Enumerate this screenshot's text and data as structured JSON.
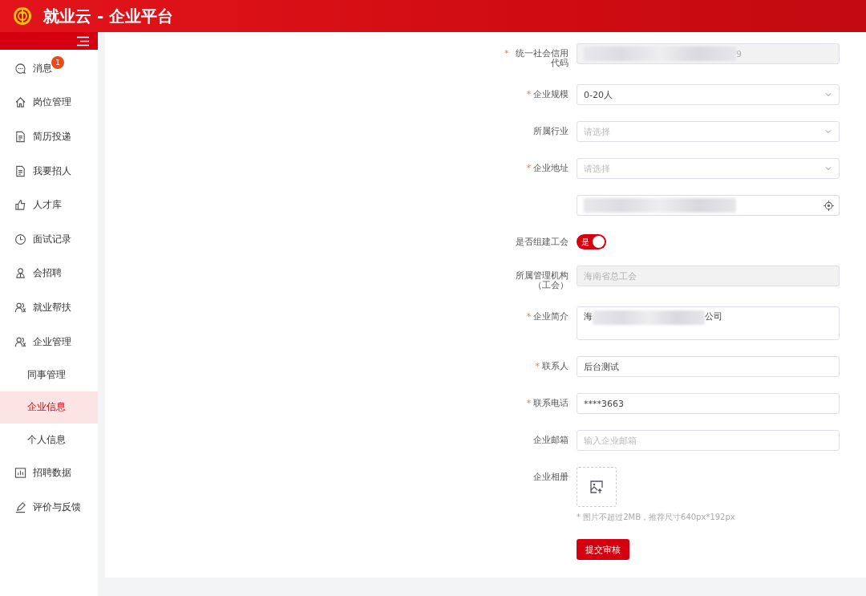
{
  "header": {
    "title": "就业云 - 企业平台"
  },
  "sidebar": {
    "items": [
      {
        "label": "消息",
        "badge": "1",
        "selected": false
      },
      {
        "label": "岗位管理",
        "selected": false
      },
      {
        "label": "简历投递",
        "selected": false
      },
      {
        "label": "我要招人",
        "selected": false
      },
      {
        "label": "人才库",
        "selected": false
      },
      {
        "label": "面试记录",
        "selected": false
      },
      {
        "label": "会招聘",
        "selected": false
      },
      {
        "label": "就业帮扶",
        "selected": false
      },
      {
        "label": "企业管理",
        "selected": false,
        "children": [
          {
            "label": "同事管理",
            "selected": false
          },
          {
            "label": "企业信息",
            "selected": true
          },
          {
            "label": "个人信息",
            "selected": false
          }
        ]
      },
      {
        "label": "招聘数据",
        "selected": false
      },
      {
        "label": "评价与反馈",
        "selected": false
      }
    ]
  },
  "form": {
    "fields": [
      {
        "kind": "masked",
        "label": "统一社会信用代码",
        "required_mark": "*",
        "disabled": true,
        "value": "9"
      },
      {
        "kind": "select",
        "label": "企业规模",
        "required_mark": "*",
        "value": "0-20人"
      },
      {
        "kind": "select",
        "label": "所属行业",
        "placeholder": "请选择"
      },
      {
        "kind": "select",
        "label": "企业地址",
        "required_mark": "*",
        "placeholder": "请选择"
      },
      {
        "kind": "location"
      },
      {
        "kind": "switch",
        "label": "是否组建工会",
        "on": true,
        "text": "是"
      },
      {
        "kind": "input",
        "label": "所属管理机构（工会）",
        "disabled": true,
        "value": "海南省总工会"
      },
      {
        "kind": "textarea",
        "label": "企业简介",
        "required_mark": "*",
        "value_start": "海",
        "value_end": "公司"
      },
      {
        "kind": "input",
        "label": "联系人",
        "required_mark": "*",
        "disabled": false,
        "value": "后台测试"
      },
      {
        "kind": "input",
        "label": "联系电话",
        "required_mark": "*",
        "disabled": false,
        "value": "****3663"
      },
      {
        "kind": "input",
        "label": "企业邮箱",
        "disabled": false,
        "placeholder": "输入企业邮箱"
      },
      {
        "kind": "upload",
        "label": "企业相册",
        "hint": "* 图片不超过2MB，推荐尺寸640px*192px"
      }
    ],
    "submit": "提交审核"
  }
}
